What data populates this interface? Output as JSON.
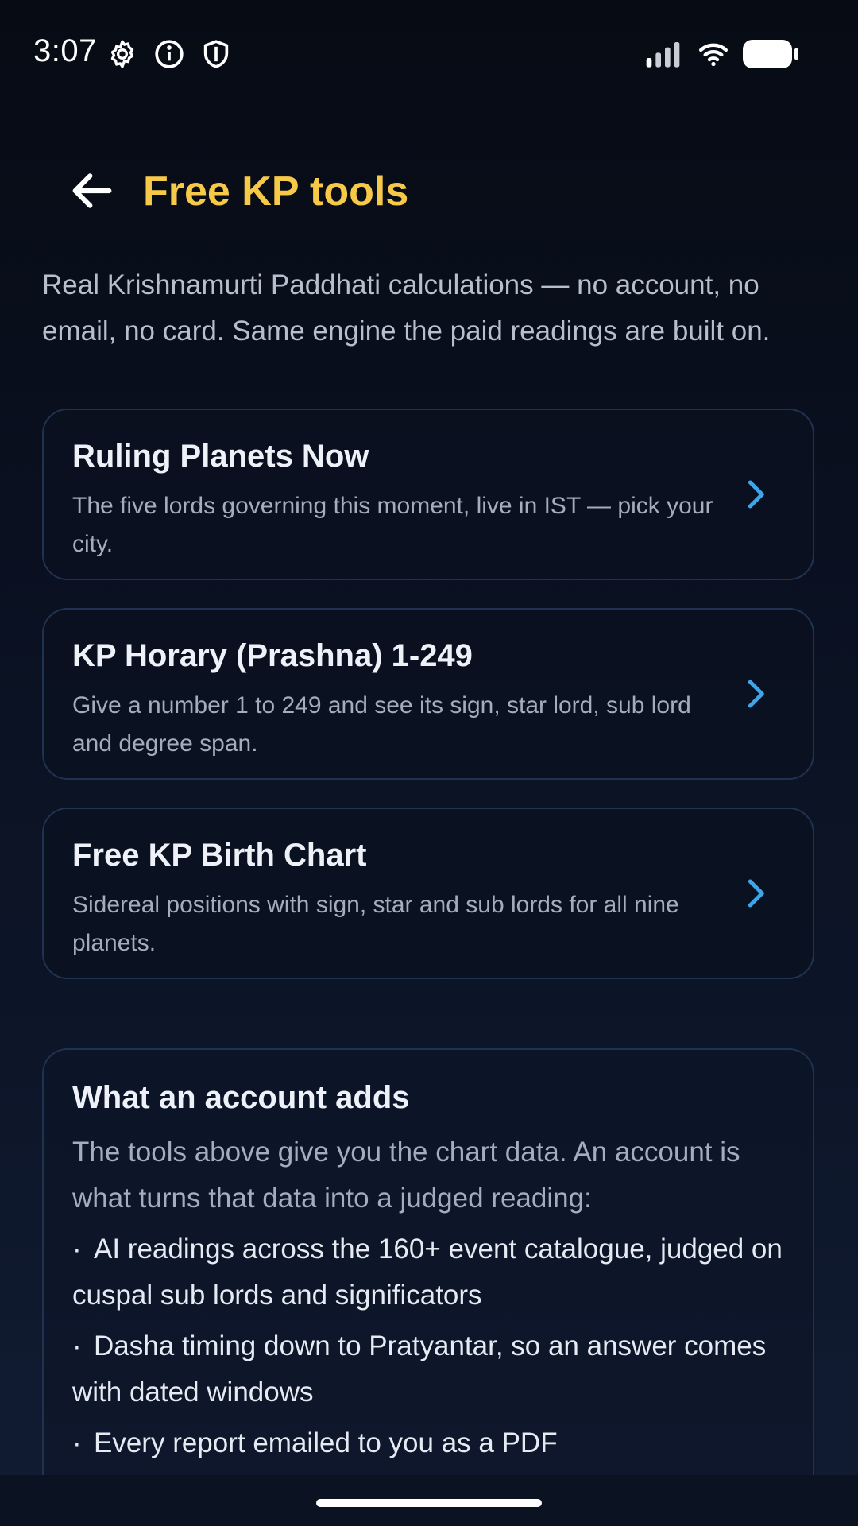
{
  "status_bar": {
    "time": "3:07",
    "icons": [
      "gear-icon",
      "info-icon",
      "shield-icon",
      "signal-icon",
      "wifi-icon",
      "battery-icon"
    ]
  },
  "header": {
    "back_icon": "arrow-left-icon",
    "title": "Free KP tools"
  },
  "intro": "Real Krishnamurti Paddhati calculations — no account, no email, no card. Same engine the paid readings are built on.",
  "tools": [
    {
      "title": "Ruling Planets Now",
      "description": "The five lords governing this moment, live in IST — pick your city."
    },
    {
      "title": "KP Horary (Prashna) 1-249",
      "description": "Give a number 1 to 249 and see its sign, star lord, sub lord and degree span."
    },
    {
      "title": "Free KP Birth Chart",
      "description": "Sidereal positions with sign, star and sub lords for all nine planets."
    }
  ],
  "account": {
    "title": "What an account adds",
    "intro": "The tools above give you the chart data. An account is what turns that data into a judged reading:",
    "bullet": "·",
    "benefits": [
      "AI readings across the 160+ event catalogue, judged on cuspal sub lords and significators",
      "Dasha timing down to Pratyantar, so an answer comes with dated windows",
      "Every report emailed to you as a PDF"
    ]
  },
  "colors": {
    "accent": "#f7c948",
    "chevron": "#3ea6e8",
    "card_border": "#1f3350",
    "background": "#0b1120"
  }
}
